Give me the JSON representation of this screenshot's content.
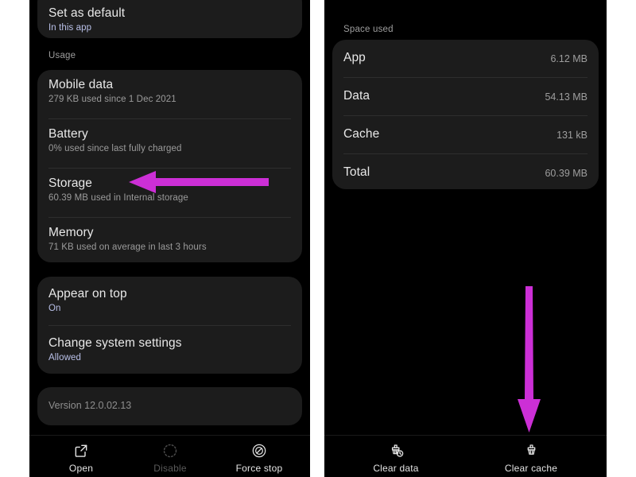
{
  "colors": {
    "arrow": "#cc2fd6",
    "panel_bg": "#000000",
    "card_bg": "#1c1c1c",
    "title": "#e8e8e8",
    "subtitle": "#9b9b9b",
    "accent_sub": "#b9c0e8"
  },
  "left_panel": {
    "default_card": {
      "title": "Set as default",
      "subtitle": "In this app"
    },
    "usage_section_label": "Usage",
    "usage_rows": [
      {
        "title": "Mobile data",
        "subtitle": "279 KB used since 1 Dec 2021"
      },
      {
        "title": "Battery",
        "subtitle": "0% used since last fully charged"
      },
      {
        "title": "Storage",
        "subtitle": "60.39 MB used in Internal storage"
      },
      {
        "title": "Memory",
        "subtitle": "71 KB used on average in last 3 hours"
      }
    ],
    "permission_rows": [
      {
        "title": "Appear on top",
        "subtitle": "On"
      },
      {
        "title": "Change system settings",
        "subtitle": "Allowed"
      }
    ],
    "version_text": "Version 12.0.02.13",
    "bottom_actions": [
      {
        "label": "Open",
        "icon": "external-link-icon",
        "disabled": false
      },
      {
        "label": "Disable",
        "icon": "disable-dashed-circle-icon",
        "disabled": true
      },
      {
        "label": "Force stop",
        "icon": "force-stop-icon",
        "disabled": false
      }
    ]
  },
  "right_panel": {
    "section_label": "Space used",
    "storage_rows": [
      {
        "label": "App",
        "value": "6.12 MB"
      },
      {
        "label": "Data",
        "value": "54.13 MB"
      },
      {
        "label": "Cache",
        "value": "131 kB"
      },
      {
        "label": "Total",
        "value": "60.39 MB"
      }
    ],
    "bottom_actions": [
      {
        "label": "Clear data",
        "icon": "clear-data-broom-icon"
      },
      {
        "label": "Clear cache",
        "icon": "clear-cache-broom-icon"
      }
    ]
  },
  "annotations": {
    "left_arrow": {
      "points_to": "Storage",
      "direction": "left"
    },
    "right_arrow": {
      "points_to": "Clear cache",
      "direction": "down"
    }
  }
}
